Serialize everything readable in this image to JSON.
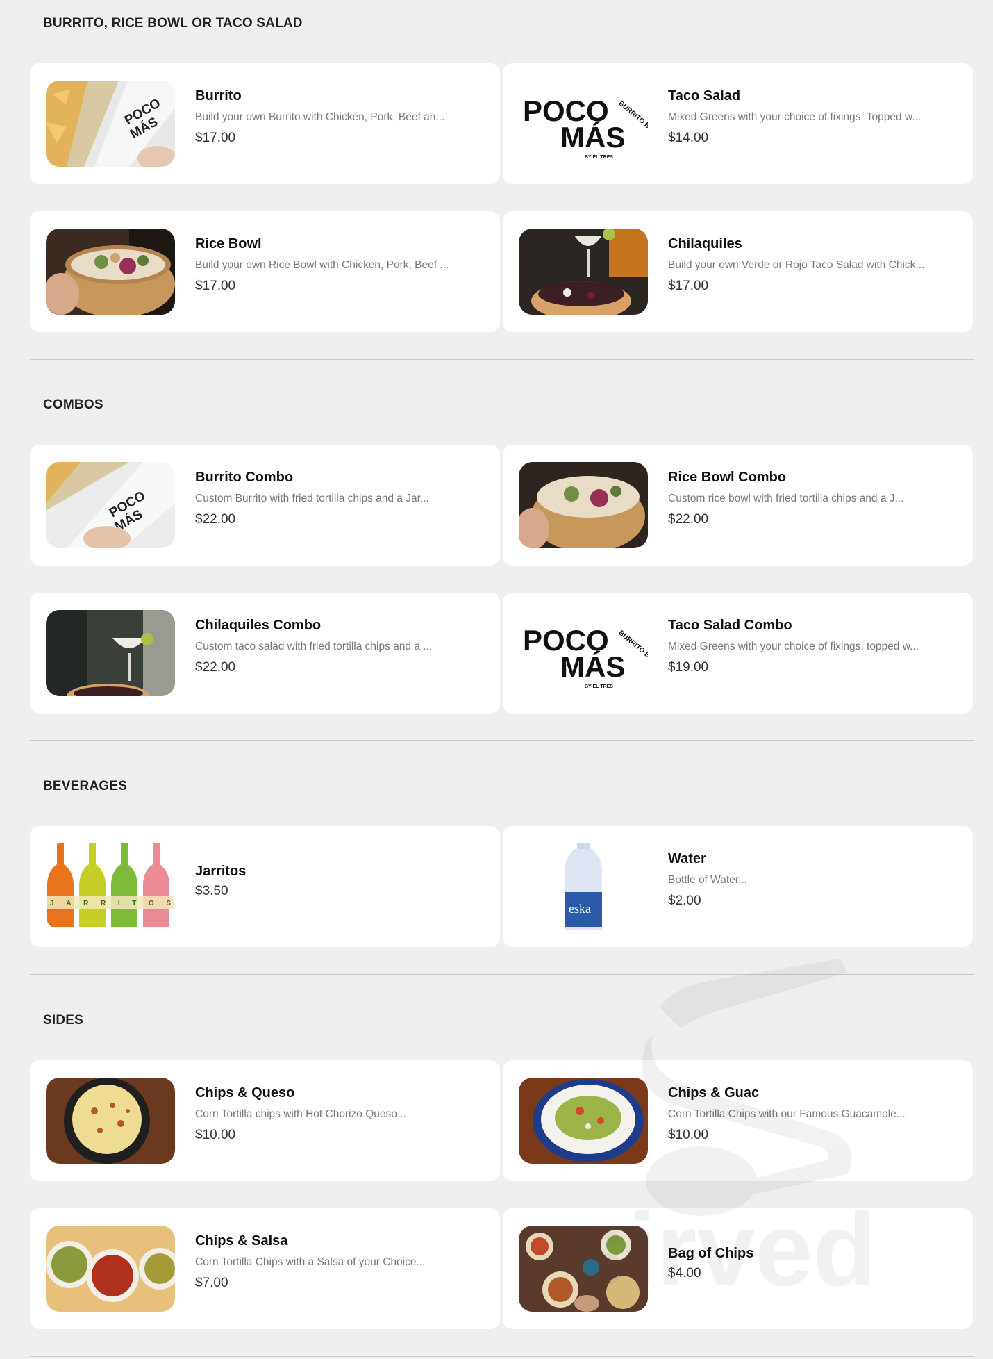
{
  "sections": [
    {
      "title": "BURRITO, RICE BOWL OR TACO SALAD",
      "items": [
        {
          "name": "Burrito",
          "description": "Build your own Burrito with Chicken, Pork, Beef an...",
          "price": "$17.00",
          "image": "burrito-wrap-photo"
        },
        {
          "name": "Taco Salad",
          "description": "Mixed Greens with your choice of fixings. Topped w...",
          "price": "$14.00",
          "image": "poco-mas-logo"
        },
        {
          "name": "Rice Bowl",
          "description": "Build your own Rice Bowl with Chicken, Pork, Beef ...",
          "price": "$17.00",
          "image": "rice-bowl-photo"
        },
        {
          "name": "Chilaquiles",
          "description": "Build your own Verde or Rojo Taco Salad with Chick...",
          "price": "$17.00",
          "image": "chilaquiles-margarita-photo"
        }
      ]
    },
    {
      "title": "COMBOS",
      "items": [
        {
          "name": "Burrito Combo",
          "description": "Custom Burrito with fried tortilla chips and a Jar...",
          "price": "$22.00",
          "image": "burrito-wrap-photo"
        },
        {
          "name": "Rice Bowl Combo",
          "description": "Custom rice bowl with fried tortilla chips and a J...",
          "price": "$22.00",
          "image": "rice-bowl-photo"
        },
        {
          "name": "Chilaquiles Combo",
          "description": "Custom taco salad with fried tortilla chips and a ...",
          "price": "$22.00",
          "image": "chilaquiles-margarita-photo"
        },
        {
          "name": "Taco Salad Combo",
          "description": "Mixed Greens with your choice of fixings, topped w...",
          "price": "$19.00",
          "image": "poco-mas-logo"
        }
      ]
    },
    {
      "title": "BEVERAGES",
      "items": [
        {
          "name": "Jarritos",
          "description": "",
          "price": "$3.50",
          "image": "jarritos-bottles-photo"
        },
        {
          "name": "Water",
          "description": "Bottle of Water...",
          "price": "$2.00",
          "image": "water-bottle-photo"
        }
      ]
    },
    {
      "title": "SIDES",
      "items": [
        {
          "name": "Chips & Queso",
          "description": "Corn Tortilla chips with Hot Chorizo Queso...",
          "price": "$10.00",
          "image": "queso-skillet-photo"
        },
        {
          "name": "Chips & Guac",
          "description": "Corn Tortilla Chips with our Famous Guacamole...",
          "price": "$10.00",
          "image": "guacamole-bowl-photo"
        },
        {
          "name": "Chips & Salsa",
          "description": "Corn Tortilla Chips with a Salsa of your Choice...",
          "price": "$7.00",
          "image": "salsa-bowls-photo"
        },
        {
          "name": "Bag of Chips",
          "description": "",
          "price": "$4.00",
          "image": "table-spread-photo"
        }
      ]
    }
  ],
  "logo": {
    "line1": "POCO",
    "line2": "MÁS",
    "arc_text": "BURRITO BAR",
    "tagline": "BY EL TRES"
  },
  "jarritos_label": "JARRITOS",
  "water_label": "eska",
  "watermark_text": "sirved",
  "colors": {
    "card": "#ffffff",
    "background": "#f0efee",
    "divider": "#c9c9c9",
    "price": "#333333",
    "description": "#777777"
  }
}
